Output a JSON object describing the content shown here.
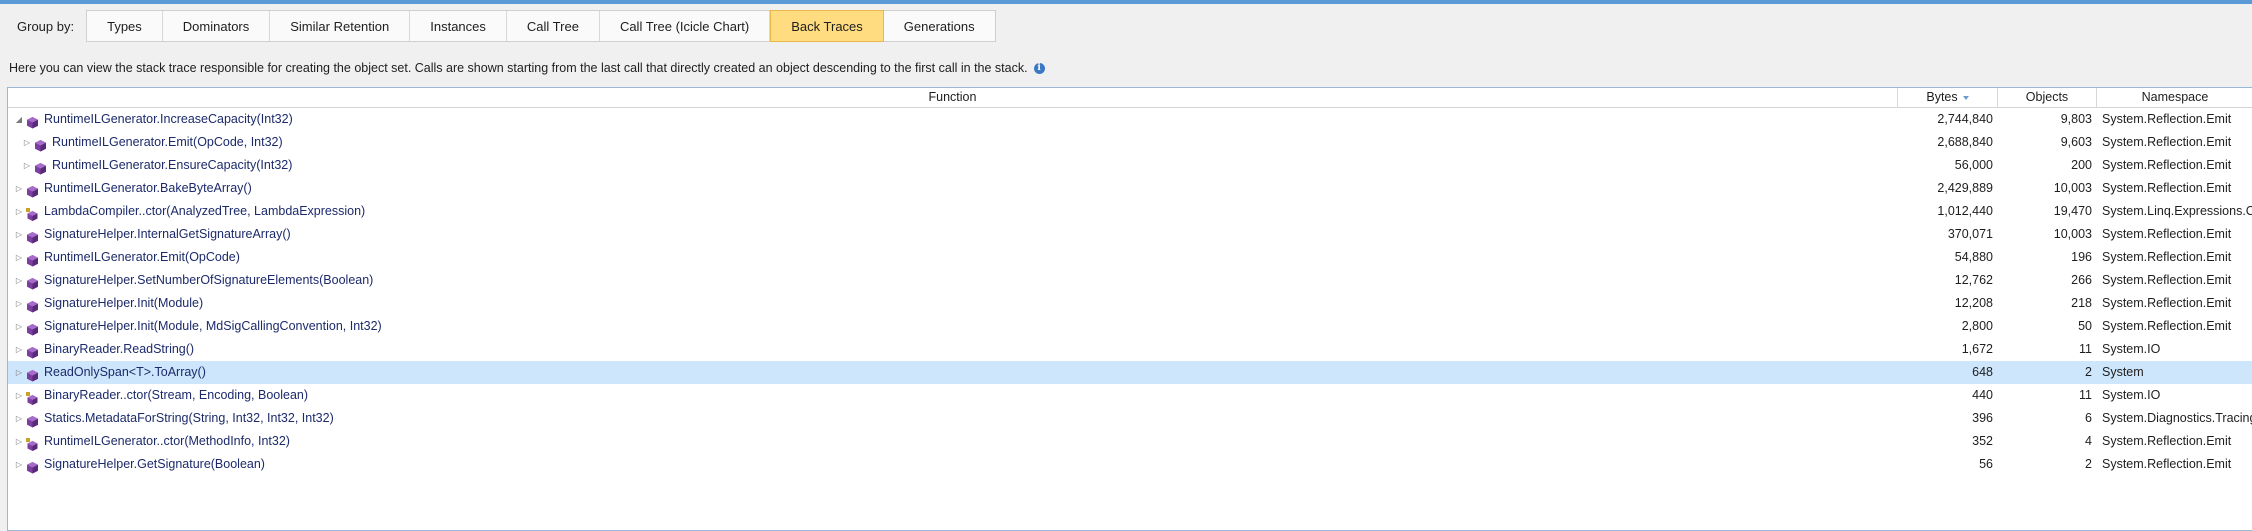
{
  "group_by": {
    "label": "Group by:",
    "tabs": [
      "Types",
      "Dominators",
      "Similar Retention",
      "Instances",
      "Call Tree",
      "Call Tree (Icicle Chart)",
      "Back Traces",
      "Generations"
    ],
    "active": "Back Traces"
  },
  "hint": "Here you can view the stack trace responsible for creating the object set. Calls are shown starting from the last call that directly created an object descending to the first call in the stack.",
  "columns": {
    "function": "Function",
    "bytes": "Bytes",
    "objects": "Objects",
    "namespace": "Namespace"
  },
  "rows": [
    {
      "fn": "RuntimeILGenerator.IncreaseCapacity(Int32)",
      "bytes": "2,744,840",
      "objects": "9,803",
      "ns": "System.Reflection.Emit",
      "level": 0,
      "expanded": true,
      "icon": "method-icon"
    },
    {
      "fn": "RuntimeILGenerator.Emit(OpCode, Int32)",
      "bytes": "2,688,840",
      "objects": "9,603",
      "ns": "System.Reflection.Emit",
      "level": 1,
      "expanded": false,
      "icon": "method-icon"
    },
    {
      "fn": "RuntimeILGenerator.EnsureCapacity(Int32)",
      "bytes": "56,000",
      "objects": "200",
      "ns": "System.Reflection.Emit",
      "level": 1,
      "expanded": false,
      "icon": "method-icon"
    },
    {
      "fn": "RuntimeILGenerator.BakeByteArray()",
      "bytes": "2,429,889",
      "objects": "10,003",
      "ns": "System.Reflection.Emit",
      "level": 0,
      "expanded": false,
      "icon": "method-icon"
    },
    {
      "fn": "LambdaCompiler..ctor(AnalyzedTree, LambdaExpression)",
      "bytes": "1,012,440",
      "objects": "19,470",
      "ns": "System.Linq.Expressions.Compiler",
      "level": 0,
      "expanded": false,
      "icon": "constructor-icon"
    },
    {
      "fn": "SignatureHelper.InternalGetSignatureArray()",
      "bytes": "370,071",
      "objects": "10,003",
      "ns": "System.Reflection.Emit",
      "level": 0,
      "expanded": false,
      "icon": "method-icon"
    },
    {
      "fn": "RuntimeILGenerator.Emit(OpCode)",
      "bytes": "54,880",
      "objects": "196",
      "ns": "System.Reflection.Emit",
      "level": 0,
      "expanded": false,
      "icon": "method-icon"
    },
    {
      "fn": "SignatureHelper.SetNumberOfSignatureElements(Boolean)",
      "bytes": "12,762",
      "objects": "266",
      "ns": "System.Reflection.Emit",
      "level": 0,
      "expanded": false,
      "icon": "method-icon"
    },
    {
      "fn": "SignatureHelper.Init(Module)",
      "bytes": "12,208",
      "objects": "218",
      "ns": "System.Reflection.Emit",
      "level": 0,
      "expanded": false,
      "icon": "method-icon"
    },
    {
      "fn": "SignatureHelper.Init(Module, MdSigCallingConvention, Int32)",
      "bytes": "2,800",
      "objects": "50",
      "ns": "System.Reflection.Emit",
      "level": 0,
      "expanded": false,
      "icon": "method-icon"
    },
    {
      "fn": "BinaryReader.ReadString()",
      "bytes": "1,672",
      "objects": "11",
      "ns": "System.IO",
      "level": 0,
      "expanded": false,
      "icon": "method-icon"
    },
    {
      "fn": "ReadOnlySpan<T>.ToArray()",
      "bytes": "648",
      "objects": "2",
      "ns": "System",
      "level": 0,
      "expanded": false,
      "icon": "method-icon",
      "selected": true
    },
    {
      "fn": "BinaryReader..ctor(Stream, Encoding, Boolean)",
      "bytes": "440",
      "objects": "11",
      "ns": "System.IO",
      "level": 0,
      "expanded": false,
      "icon": "constructor-icon"
    },
    {
      "fn": "Statics.MetadataForString(String, Int32, Int32, Int32)",
      "bytes": "396",
      "objects": "6",
      "ns": "System.Diagnostics.Tracing",
      "level": 0,
      "expanded": false,
      "icon": "method-icon"
    },
    {
      "fn": "RuntimeILGenerator..ctor(MethodInfo, Int32)",
      "bytes": "352",
      "objects": "4",
      "ns": "System.Reflection.Emit",
      "level": 0,
      "expanded": false,
      "icon": "constructor-icon"
    },
    {
      "fn": "SignatureHelper.GetSignature(Boolean)",
      "bytes": "56",
      "objects": "2",
      "ns": "System.Reflection.Emit",
      "level": 0,
      "expanded": false,
      "icon": "method-icon"
    }
  ]
}
